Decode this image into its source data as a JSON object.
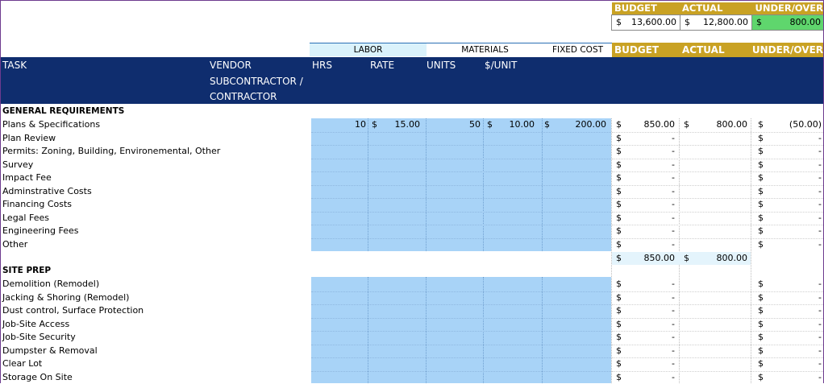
{
  "summary": {
    "headers": [
      "BUDGET",
      "ACTUAL",
      "UNDER/OVER"
    ],
    "currency": "$",
    "budget": "13,600.00",
    "actual": "12,800.00",
    "under_over": "800.00"
  },
  "groups": {
    "labor": "LABOR",
    "materials": "MATERIALS",
    "fixed_cost": "FIXED COST",
    "budget": "BUDGET",
    "actual": "ACTUAL",
    "under_over": "UNDER/OVER"
  },
  "columns": {
    "task": "TASK",
    "vendor": "VENDOR",
    "subcontractor": "SUBCONTRACTOR /",
    "contractor": "CONTRACTOR",
    "hrs": "HRS",
    "rate": "RATE",
    "units": "UNITS",
    "per_unit": "$/UNIT"
  },
  "sections": [
    {
      "title": "GENERAL REQUIREMENTS",
      "rows": [
        {
          "task": "Plans & Specifications",
          "hrs": "10",
          "rate_cur": "$",
          "rate": "15.00",
          "units": "50",
          "unit_cur": "$",
          "per_unit": "10.00",
          "fixed_cur": "$",
          "fixed": "200.00",
          "budget": "850.00",
          "actual_cur": "$",
          "actual": "800.00",
          "under_over": "(50.00)"
        },
        {
          "task": "Plan Review",
          "budget": "-",
          "under_over": "-"
        },
        {
          "task": "Permits: Zoning, Building, Environemental, Other",
          "budget": "-",
          "under_over": "-"
        },
        {
          "task": "Survey",
          "budget": "-",
          "under_over": "-"
        },
        {
          "task": "Impact Fee",
          "budget": "-",
          "under_over": "-"
        },
        {
          "task": "Adminstrative Costs",
          "budget": "-",
          "under_over": "-"
        },
        {
          "task": "Financing Costs",
          "budget": "-",
          "under_over": "-"
        },
        {
          "task": "Legal Fees",
          "budget": "-",
          "under_over": "-"
        },
        {
          "task": "Engineering Fees",
          "budget": "-",
          "under_over": "-"
        },
        {
          "task": "Other",
          "budget": "-",
          "under_over": "-"
        }
      ],
      "total": {
        "budget_cur": "$",
        "budget": "850.00",
        "actual_cur": "$",
        "actual": "800.00"
      }
    },
    {
      "title": "SITE PREP",
      "rows": [
        {
          "task": "Demolition (Remodel)",
          "budget": "-",
          "under_over": "-"
        },
        {
          "task": "Jacking & Shoring (Remodel)",
          "budget": "-",
          "under_over": "-"
        },
        {
          "task": "Dust control, Surface Protection",
          "budget": "-",
          "under_over": "-"
        },
        {
          "task": "Job-Site Access",
          "budget": "-",
          "under_over": "-"
        },
        {
          "task": "Job-Site Security",
          "budget": "-",
          "under_over": "-"
        },
        {
          "task": "Dumpster & Removal",
          "budget": "-",
          "under_over": "-"
        },
        {
          "task": "Clear Lot",
          "budget": "-",
          "under_over": "-"
        },
        {
          "task": "Storage On Site",
          "budget": "-",
          "under_over": "-"
        }
      ]
    }
  ]
}
